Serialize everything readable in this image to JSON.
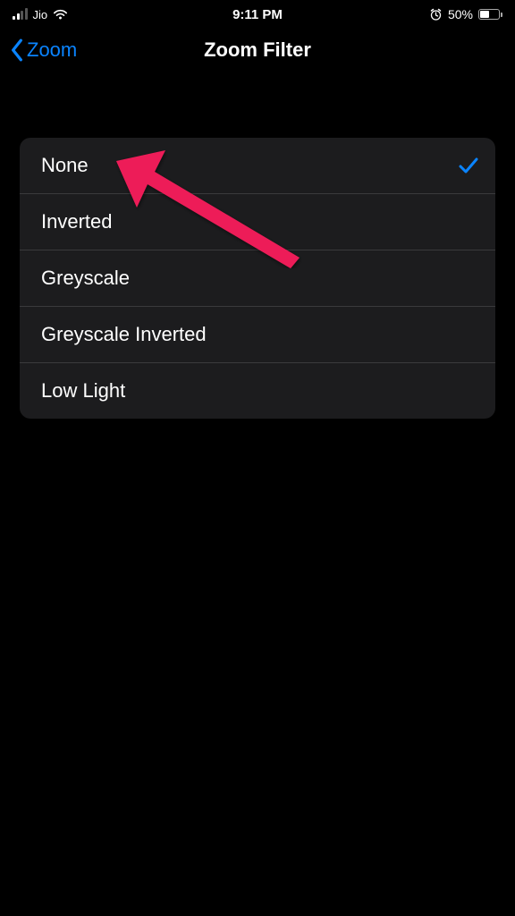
{
  "statusBar": {
    "carrier": "Jio",
    "time": "9:11 PM",
    "batteryPct": "50%"
  },
  "nav": {
    "backLabel": "Zoom",
    "title": "Zoom Filter"
  },
  "filters": [
    {
      "label": "None",
      "selected": true
    },
    {
      "label": "Inverted",
      "selected": false
    },
    {
      "label": "Greyscale",
      "selected": false
    },
    {
      "label": "Greyscale Inverted",
      "selected": false
    },
    {
      "label": "Low Light",
      "selected": false
    }
  ]
}
